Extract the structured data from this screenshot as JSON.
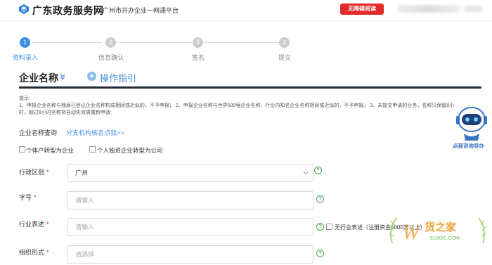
{
  "header": {
    "logo_text": "广东政务服务网",
    "subtitle": "广州市开办企业一网通平台",
    "a11y_button": "无障碍阅读",
    "accent_color": "#3a8ee6",
    "logo_icon": "gd-gov-logo-icon"
  },
  "steps": [
    {
      "num": "1",
      "label": "资料录入",
      "active": true
    },
    {
      "num": "2",
      "label": "信息确认",
      "active": false
    },
    {
      "num": "3",
      "label": "签名",
      "active": false
    },
    {
      "num": "4",
      "label": "提交",
      "active": false
    }
  ],
  "section": {
    "title": "企业名称",
    "guide": "操作指引"
  },
  "tips": {
    "heading": "提示:",
    "body": "1、申报企业名称与我局已登记企业名称构成相同或近似的，不予申报； 2、申报企业名称与世界500强企业名称、行业内知名企业名称相同或近似的，不予申报； 3、未提交申请的业务，名称只保留8小时，超过8小时名称将自动失效需重新申请;"
  },
  "form": {
    "query_label": "企业名称查询",
    "query_link": "分支机构核名点我>>",
    "checkbox1": "个体户转型为企业",
    "checkbox2": "个人独资企业转型为公司",
    "region_label": "行政区划",
    "region_value": "广州",
    "trade_label": "字号",
    "trade_placeholder": "请输入",
    "industry_label": "行业表述",
    "industry_placeholder": "请输入",
    "no_industry_label": "无行业表述（注册资金5000万以上）",
    "org_label": "组织形式",
    "org_placeholder": "请选择",
    "required_mark": "*",
    "help_mark": "?"
  },
  "robot": {
    "label": "点我咨询导办"
  },
  "watermark": {
    "text": "货之家",
    "sub": "51W2C.COM",
    "letter": "W"
  }
}
